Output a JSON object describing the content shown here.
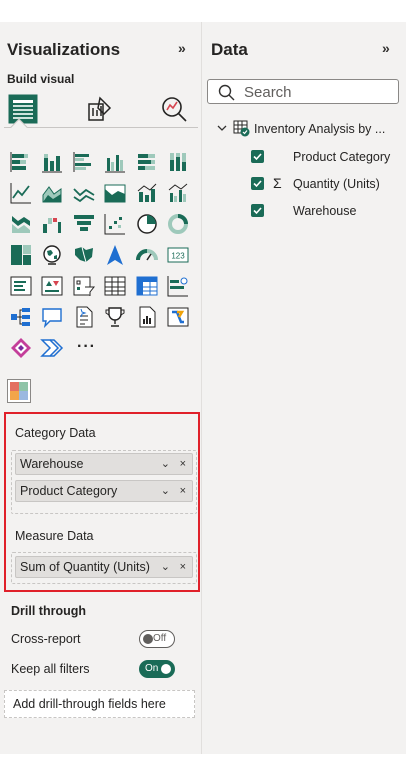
{
  "visualizations": {
    "title": "Visualizations",
    "collapse_glyph": "»",
    "build_visual_label": "Build visual",
    "tabs": [
      "build-visual-icon",
      "format-visual-icon",
      "analytics-icon"
    ],
    "more_glyph": "···",
    "category_well": {
      "label": "Category Data",
      "fields": [
        "Warehouse",
        "Product Category"
      ]
    },
    "measure_well": {
      "label": "Measure Data",
      "fields": [
        "Sum of Quantity (Units)"
      ]
    },
    "field_chevron": "⌄",
    "field_close": "×",
    "drill_through": {
      "title": "Drill through",
      "cross_report_label": "Cross-report",
      "cross_report_state": "Off",
      "keep_filters_label": "Keep all filters",
      "keep_filters_state": "On",
      "add_fields_placeholder": "Add drill-through fields here"
    }
  },
  "data_pane": {
    "title": "Data",
    "collapse_glyph": "»",
    "search_placeholder": "Search",
    "table_name": "Inventory Analysis by ...",
    "sigma_glyph": "Σ",
    "fields": [
      {
        "name": "Product Category",
        "checked": true
      },
      {
        "name": "Quantity (Units)",
        "checked": true,
        "aggregated": true
      },
      {
        "name": "Warehouse",
        "checked": true
      }
    ]
  },
  "colors": {
    "accent_green": "#1a6b57",
    "highlight_red": "#e0202a"
  }
}
